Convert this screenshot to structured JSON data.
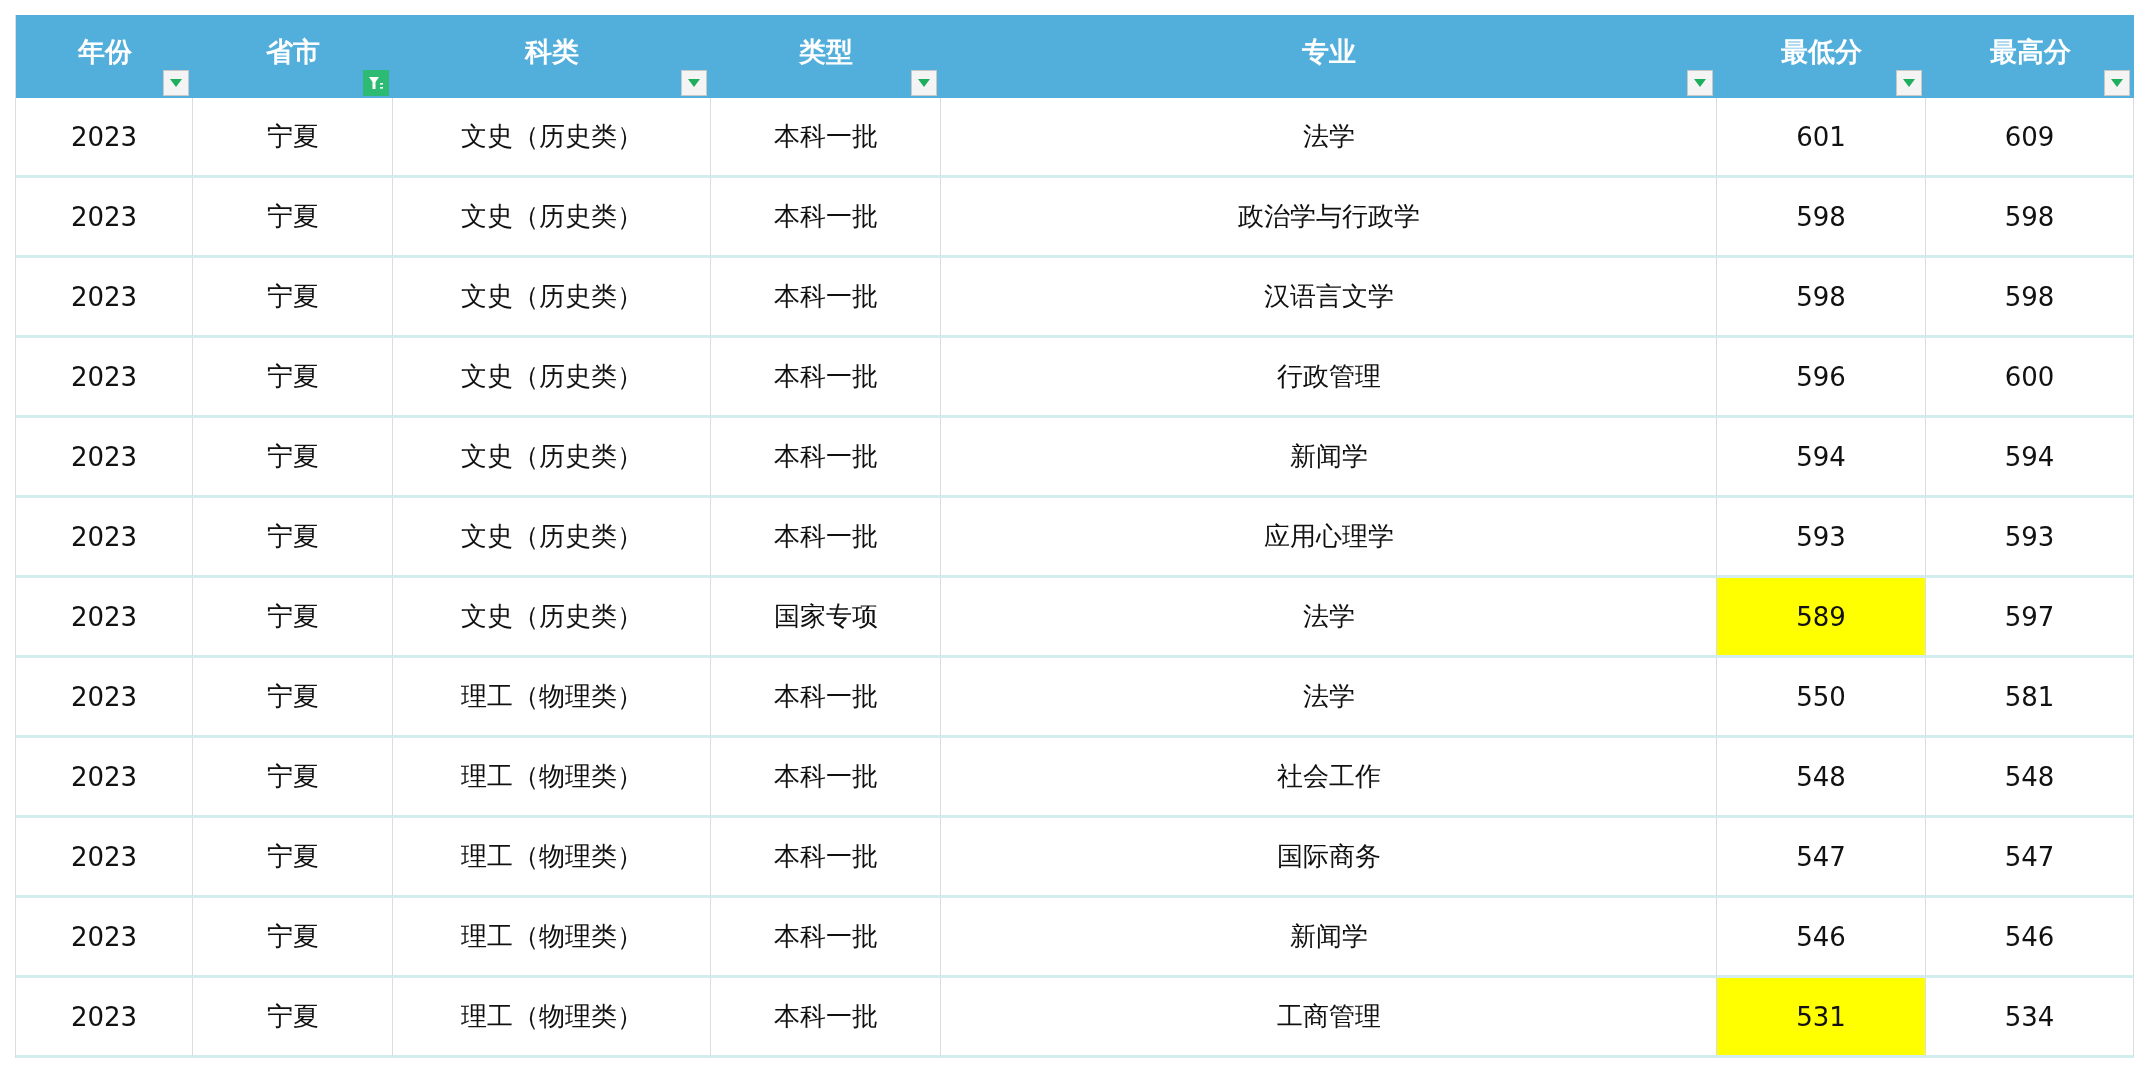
{
  "table": {
    "columns": [
      {
        "label": "年份",
        "filter_active": false
      },
      {
        "label": "省市",
        "filter_active": true
      },
      {
        "label": "科类",
        "filter_active": false
      },
      {
        "label": "类型",
        "filter_active": false
      },
      {
        "label": "专业",
        "filter_active": false
      },
      {
        "label": "最低分",
        "filter_active": false
      },
      {
        "label": "最高分",
        "filter_active": false
      }
    ],
    "rows": [
      {
        "cells": [
          "2023",
          "宁夏",
          "文史（历史类）",
          "本科一批",
          "法学",
          "601",
          "609"
        ],
        "min_score_highlighted": false
      },
      {
        "cells": [
          "2023",
          "宁夏",
          "文史（历史类）",
          "本科一批",
          "政治学与行政学",
          "598",
          "598"
        ],
        "min_score_highlighted": false
      },
      {
        "cells": [
          "2023",
          "宁夏",
          "文史（历史类）",
          "本科一批",
          "汉语言文学",
          "598",
          "598"
        ],
        "min_score_highlighted": false
      },
      {
        "cells": [
          "2023",
          "宁夏",
          "文史（历史类）",
          "本科一批",
          "行政管理",
          "596",
          "600"
        ],
        "min_score_highlighted": false
      },
      {
        "cells": [
          "2023",
          "宁夏",
          "文史（历史类）",
          "本科一批",
          "新闻学",
          "594",
          "594"
        ],
        "min_score_highlighted": false
      },
      {
        "cells": [
          "2023",
          "宁夏",
          "文史（历史类）",
          "本科一批",
          "应用心理学",
          "593",
          "593"
        ],
        "min_score_highlighted": false
      },
      {
        "cells": [
          "2023",
          "宁夏",
          "文史（历史类）",
          "国家专项",
          "法学",
          "589",
          "597"
        ],
        "min_score_highlighted": true
      },
      {
        "cells": [
          "2023",
          "宁夏",
          "理工（物理类）",
          "本科一批",
          "法学",
          "550",
          "581"
        ],
        "min_score_highlighted": false
      },
      {
        "cells": [
          "2023",
          "宁夏",
          "理工（物理类）",
          "本科一批",
          "社会工作",
          "548",
          "548"
        ],
        "min_score_highlighted": false
      },
      {
        "cells": [
          "2023",
          "宁夏",
          "理工（物理类）",
          "本科一批",
          "国际商务",
          "547",
          "547"
        ],
        "min_score_highlighted": false
      },
      {
        "cells": [
          "2023",
          "宁夏",
          "理工（物理类）",
          "本科一批",
          "新闻学",
          "546",
          "546"
        ],
        "min_score_highlighted": false
      },
      {
        "cells": [
          "2023",
          "宁夏",
          "理工（物理类）",
          "本科一批",
          "工商管理",
          "531",
          "534"
        ],
        "min_score_highlighted": true
      }
    ]
  }
}
